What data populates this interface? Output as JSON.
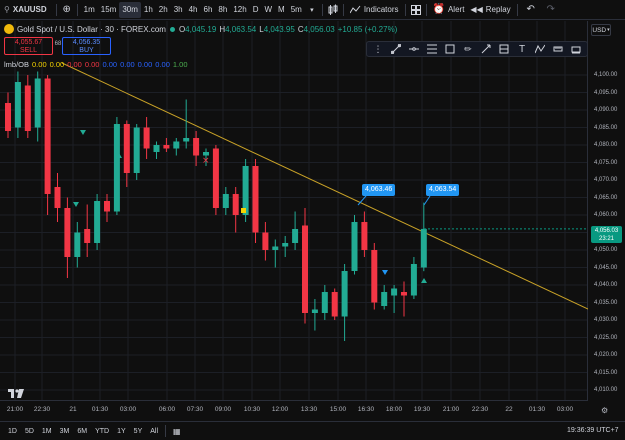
{
  "toolbar": {
    "symbol": "XAUUSD",
    "add_icon": "plus-circle-icon",
    "intervals": [
      "1m",
      "15m",
      "30m",
      "1h",
      "2h",
      "3h",
      "4h",
      "6h",
      "8h",
      "12h",
      "D",
      "W",
      "M",
      "5m"
    ],
    "active_interval": "30m",
    "indicators_label": "Indicators",
    "alert_label": "Alert",
    "replay_label": "Replay"
  },
  "legend": {
    "title": "Gold Spot / U.S. Dollar · 30 · FOREX.com",
    "open": "O",
    "open_val": "4,045.19",
    "high": "H",
    "high_val": "4,063.54",
    "low": "L",
    "low_val": "4,043.95",
    "close": "C",
    "close_val": "4,056.03",
    "change": "+10.85 (+0.27%)",
    "sell_price": "4,055.67",
    "sell_label": "SELL",
    "spread": "68",
    "buy_price": "4,056.35",
    "buy_label": "BUY",
    "indicator_name": "lmb/OB",
    "indicator_values": [
      {
        "v": "0.00",
        "color": "#f5d300"
      },
      {
        "v": "0.00",
        "color": "#f5d300"
      },
      {
        "v": "0.00",
        "color": "#f23645"
      },
      {
        "v": "0.00",
        "color": "#f23645"
      },
      {
        "v": "0.00",
        "color": "#2962ff"
      },
      {
        "v": "0.00",
        "color": "#2962ff"
      },
      {
        "v": "0.00",
        "color": "#2962ff"
      },
      {
        "v": "0.00",
        "color": "#2962ff"
      },
      {
        "v": "1.00",
        "color": "#4caf50"
      }
    ]
  },
  "currency": "USD",
  "price_scale": [
    "4,100.00",
    "4,095.00",
    "4,090.00",
    "4,085.00",
    "4,080.00",
    "4,075.00",
    "4,070.00",
    "4,065.00",
    "4,060.00",
    "4,055.00",
    "4,050.00",
    "4,045.00",
    "4,040.00",
    "4,035.00",
    "4,030.00",
    "4,025.00",
    "4,020.00",
    "4,015.00",
    "4,010.00"
  ],
  "current_price": "4,056.03",
  "countdown": "23:21",
  "time_axis": [
    "21:00",
    "22:30",
    "21",
    "01:30",
    "03:00",
    "06:00",
    "07:30",
    "09:00",
    "10:30",
    "12:00",
    "13:30",
    "15:00",
    "16:30",
    "18:00",
    "19:30",
    "21:00",
    "22:30",
    "22",
    "01:30",
    "03:00"
  ],
  "callouts": [
    "4,063.46",
    "4,063.54"
  ],
  "ranges": [
    "1D",
    "5D",
    "1M",
    "3M",
    "6M",
    "YTD",
    "1Y",
    "5Y",
    "All"
  ],
  "clock": "19:36:39 UTC+7",
  "colors": {
    "up": "#22ab94",
    "down": "#f23645",
    "trend": "#c9a227"
  },
  "chart_data": {
    "type": "candlestick",
    "ylim": [
      4010,
      4102
    ],
    "candles": [
      {
        "o": 4092,
        "h": 4095,
        "l": 4082,
        "c": 4084
      },
      {
        "o": 4085,
        "h": 4101,
        "l": 4082,
        "c": 4098
      },
      {
        "o": 4097,
        "h": 4100,
        "l": 4082,
        "c": 4084
      },
      {
        "o": 4085,
        "h": 4101,
        "l": 4081,
        "c": 4099
      },
      {
        "o": 4099,
        "h": 4100,
        "l": 4060,
        "c": 4066
      },
      {
        "o": 4068,
        "h": 4072,
        "l": 4058,
        "c": 4062
      },
      {
        "o": 4062,
        "h": 4065,
        "l": 4042,
        "c": 4048
      },
      {
        "o": 4048,
        "h": 4058,
        "l": 4045,
        "c": 4055
      },
      {
        "o": 4056,
        "h": 4063,
        "l": 4048,
        "c": 4052
      },
      {
        "o": 4052,
        "h": 4066,
        "l": 4050,
        "c": 4064
      },
      {
        "o": 4064,
        "h": 4066,
        "l": 4058,
        "c": 4061
      },
      {
        "o": 4061,
        "h": 4088,
        "l": 4060,
        "c": 4086
      },
      {
        "o": 4086,
        "h": 4087,
        "l": 4068,
        "c": 4072
      },
      {
        "o": 4072,
        "h": 4086,
        "l": 4070,
        "c": 4085
      },
      {
        "o": 4085,
        "h": 4088,
        "l": 4076,
        "c": 4079
      },
      {
        "o": 4078,
        "h": 4081,
        "l": 4076,
        "c": 4080
      },
      {
        "o": 4080,
        "h": 4082,
        "l": 4078,
        "c": 4079
      },
      {
        "o": 4079,
        "h": 4082,
        "l": 4077,
        "c": 4081
      },
      {
        "o": 4081,
        "h": 4093,
        "l": 4079,
        "c": 4082
      },
      {
        "o": 4082,
        "h": 4084,
        "l": 4074,
        "c": 4077
      },
      {
        "o": 4077,
        "h": 4079,
        "l": 4074,
        "c": 4078
      },
      {
        "o": 4079,
        "h": 4080,
        "l": 4060,
        "c": 4062
      },
      {
        "o": 4062,
        "h": 4068,
        "l": 4060,
        "c": 4066
      },
      {
        "o": 4066,
        "h": 4068,
        "l": 4055,
        "c": 4060
      },
      {
        "o": 4060,
        "h": 4076,
        "l": 4058,
        "c": 4074
      },
      {
        "o": 4074,
        "h": 4076,
        "l": 4052,
        "c": 4055
      },
      {
        "o": 4055,
        "h": 4058,
        "l": 4047,
        "c": 4050
      },
      {
        "o": 4050,
        "h": 4053,
        "l": 4045,
        "c": 4051
      },
      {
        "o": 4051,
        "h": 4054,
        "l": 4048,
        "c": 4052
      },
      {
        "o": 4052,
        "h": 4061,
        "l": 4050,
        "c": 4056
      },
      {
        "o": 4057,
        "h": 4062,
        "l": 4029,
        "c": 4032
      },
      {
        "o": 4032,
        "h": 4036,
        "l": 4027,
        "c": 4033
      },
      {
        "o": 4032,
        "h": 4040,
        "l": 4030,
        "c": 4038
      },
      {
        "o": 4038,
        "h": 4039,
        "l": 4030,
        "c": 4031
      },
      {
        "o": 4031,
        "h": 4046,
        "l": 4024,
        "c": 4044
      },
      {
        "o": 4044,
        "h": 4060,
        "l": 4043,
        "c": 4058
      },
      {
        "o": 4058,
        "h": 4061,
        "l": 4048,
        "c": 4050
      },
      {
        "o": 4050,
        "h": 4052,
        "l": 4033,
        "c": 4035
      },
      {
        "o": 4034,
        "h": 4040,
        "l": 4033,
        "c": 4038
      },
      {
        "o": 4037,
        "h": 4040,
        "l": 4032,
        "c": 4039
      },
      {
        "o": 4038,
        "h": 4041,
        "l": 4031,
        "c": 4037
      },
      {
        "o": 4037,
        "h": 4048,
        "l": 4036,
        "c": 4046
      },
      {
        "o": 4045,
        "h": 4063.54,
        "l": 4043.95,
        "c": 4056.03
      }
    ]
  }
}
